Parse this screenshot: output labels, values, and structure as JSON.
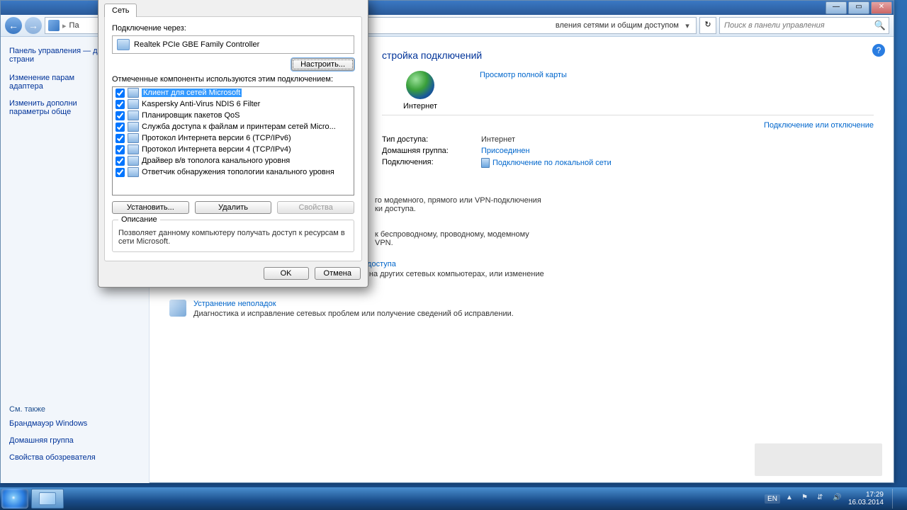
{
  "window": {
    "min": "—",
    "max": "▭",
    "close": "✕"
  },
  "addressbar": {
    "crumb1": "Па",
    "crumb2": "вления сетями и общим доступом",
    "refresh": "↻",
    "search_placeholder": "Поиск в панели управления",
    "search_icon": "🔍"
  },
  "sidebar": {
    "home": "Панель управления — домашняя страни",
    "link1": "Изменение парам\nадаптера",
    "link2": "Изменить дополни\nпараметры обще",
    "see_also": "См. также",
    "firewall": "Брандмауэр Windows",
    "homegroup": "Домашняя группа",
    "inetopt": "Свойства обозревателя"
  },
  "main": {
    "title": "стройка подключений",
    "internet": "Интернет",
    "full_map": "Просмотр полной карты",
    "conn_or_disc": "Подключение или отключение",
    "access_type_lbl": "Тип доступа:",
    "access_type_val": "Интернет",
    "homegroup_lbl": "Домашняя группа:",
    "homegroup_val": "Присоединен",
    "connections_lbl": "Подключения:",
    "connections_val": "Подключение по локальной сети",
    "sec1_title": "",
    "sec1_desc1": "го модемного, прямого или VPN-подключения",
    "sec1_desc2": "ки доступа.",
    "sec2_desc1": "к беспроводному, проводному, модемному",
    "sec2_desc2": "VPN.",
    "homegroup_link": "Выбор домашней группы и параметров общего доступа",
    "homegroup_desc": "Доступ к файлам и принтерам, расположенным на других сетевых компьютерах, или изменение параметров общего доступа.",
    "troubleshoot_link": "Устранение неполадок",
    "troubleshoot_desc": "Диагностика и исправление сетевых проблем или получение сведений об исправлении.",
    "help": "?"
  },
  "dialog": {
    "tab": "Сеть",
    "conn_via": "Подключение через:",
    "adapter": "Realtek PCIe GBE Family Controller",
    "configure": "Настроить...",
    "components_lbl": "Отмеченные компоненты используются этим подключением:",
    "components": [
      {
        "checked": true,
        "label": "Клиент для сетей Microsoft",
        "selected": true
      },
      {
        "checked": true,
        "label": "Kaspersky Anti-Virus NDIS 6 Filter"
      },
      {
        "checked": true,
        "label": "Планировщик пакетов QoS"
      },
      {
        "checked": true,
        "label": "Служба доступа к файлам и принтерам сетей Micro..."
      },
      {
        "checked": true,
        "label": "Протокол Интернета версии 6 (TCP/IPv6)"
      },
      {
        "checked": true,
        "label": "Протокол Интернета версии 4 (TCP/IPv4)"
      },
      {
        "checked": true,
        "label": "Драйвер в/в тополога канального уровня"
      },
      {
        "checked": true,
        "label": "Ответчик обнаружения топологии канального уровня"
      }
    ],
    "install": "Установить...",
    "remove": "Удалить",
    "properties": "Свойства",
    "desc_heading": "Описание",
    "desc_text": "Позволяет данному компьютеру получать доступ к ресурсам в сети Microsoft.",
    "ok": "OK",
    "cancel": "Отмена"
  },
  "taskbar": {
    "lang": "EN",
    "time": "17:29",
    "date": "16.03.2014"
  }
}
